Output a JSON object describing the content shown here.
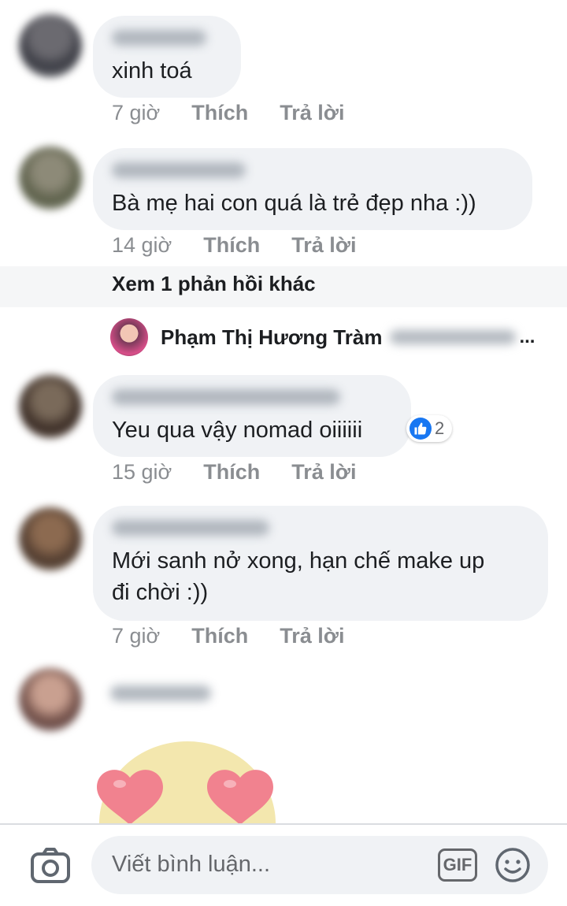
{
  "comments": [
    {
      "text": "xinh toá",
      "time": "7 giờ",
      "like": "Thích",
      "reply": "Trả lời"
    },
    {
      "text": "Bà mẹ hai con quá là trẻ đẹp nha :))",
      "time": "14 giờ",
      "like": "Thích",
      "reply": "Trả lời"
    },
    {
      "text": "Yeu qua vậy nomad oiiiiii",
      "time": "15 giờ",
      "like": "Thích",
      "reply": "Trả lời",
      "reaction_count": "2"
    },
    {
      "text": "Mới sanh nở xong, hạn chế make up\nđi chời :))",
      "time": "7 giờ",
      "like": "Thích",
      "reply": "Trả lời"
    }
  ],
  "more_replies": "Xem 1 phản hồi khác",
  "reply_preview": {
    "name": "Phạm Thị Hương Tràm",
    "ellipsis": "..."
  },
  "composer": {
    "placeholder": "Viết bình luận...",
    "gif_label": "GIF"
  },
  "colors": {
    "bubble": "#f0f2f5",
    "meta": "#8a8d91",
    "like_blue": "#1877f2"
  },
  "icons": [
    "camera-icon",
    "gif-icon",
    "emoji-icon",
    "like-icon",
    "heart-eyes-sticker"
  ]
}
